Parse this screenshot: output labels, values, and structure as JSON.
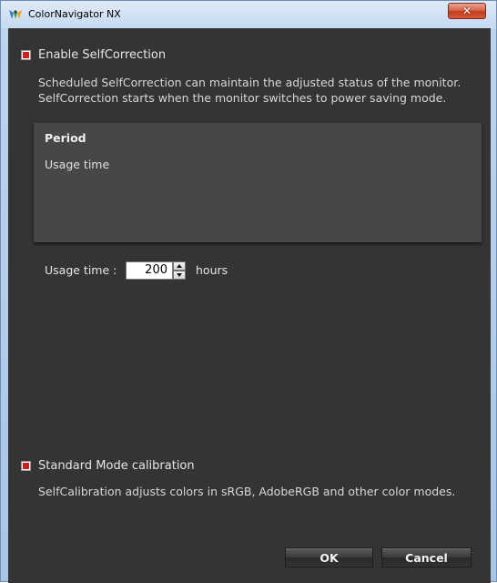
{
  "window": {
    "title": "ColorNavigator NX",
    "close_icon": "x-icon"
  },
  "self_correction": {
    "checked": true,
    "label": "Enable SelfCorrection",
    "description_line1": "Scheduled SelfCorrection can maintain the adjusted status of the monitor.",
    "description_line2": "SelfCorrection starts when the monitor switches to power saving mode."
  },
  "period_panel": {
    "title": "Period",
    "item": "Usage time"
  },
  "usage_time": {
    "label": "Usage time :",
    "value": "200",
    "unit": "hours"
  },
  "standard_mode": {
    "checked": true,
    "label": "Standard Mode calibration",
    "description": "SelfCalibration adjusts colors in sRGB,  AdobeRGB and other color modes."
  },
  "buttons": {
    "ok": "OK",
    "cancel": "Cancel"
  },
  "colors": {
    "client_bg": "#343434",
    "panel_bg": "#474747",
    "checkbox_red": "#cc1f1f",
    "close_red": "#c23e1d"
  }
}
